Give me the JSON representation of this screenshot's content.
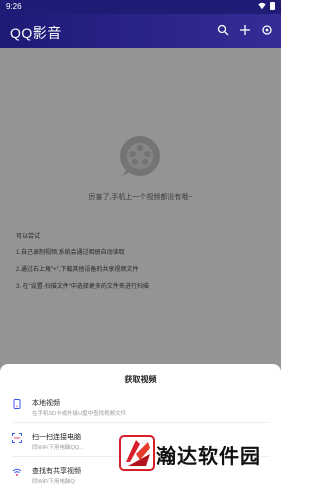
{
  "status": {
    "time": "9:26"
  },
  "appbar": {
    "title": "QQ影音",
    "icons": [
      "search-icon",
      "plus-icon",
      "settings-icon"
    ]
  },
  "main": {
    "empty_message": "厉害了,手机上一个视频都没有哦~",
    "tips_head": "可以尝试",
    "tips": [
      "1.自己录制视频,系统会通过相册自动读取",
      "2.通过右上角\"+\",下载其他设备的共享视频文件",
      "3. 在\"设置-扫描文件\"中选择更多的文件夹进行扫描"
    ]
  },
  "sheet": {
    "title": "获取视频",
    "options": [
      {
        "label": "本地视频",
        "desc": "在手机SD卡或外接U盘中查找视频文件"
      },
      {
        "label": "扫一扫连接电脑",
        "desc": "同WiFi下用电脑QQ..."
      },
      {
        "label": "查找有共享视频",
        "desc": "同WiFi下用电脑Q"
      }
    ]
  },
  "watermark": {
    "text": "瀚达软件园"
  },
  "colors": {
    "appbar": "#1d1a76",
    "accent": "#3f57f2",
    "overlay": "rgba(0,0,0,0.42)"
  }
}
